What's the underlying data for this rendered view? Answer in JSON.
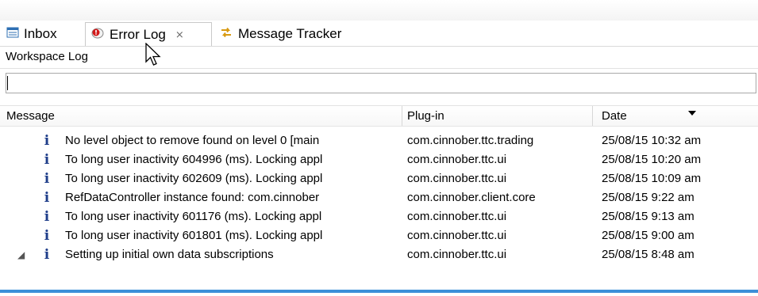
{
  "tabs": [
    {
      "label": "Inbox",
      "icon": "inbox-icon"
    },
    {
      "label": "Error Log",
      "icon": "error-log-icon",
      "close": "⨯"
    },
    {
      "label": "Message Tracker",
      "icon": "message-tracker-icon"
    }
  ],
  "view_title": "Workspace Log",
  "filter": {
    "value": "",
    "placeholder": ""
  },
  "columns": {
    "message": "Message",
    "plugin": "Plug-in",
    "date": "Date"
  },
  "rows": [
    {
      "message": "No level object to remove found on level 0 [main",
      "plugin": "com.cinnober.ttc.trading",
      "date": "25/08/15 10:32 am"
    },
    {
      "message": "To long user inactivity 604996 (ms). Locking appl",
      "plugin": "com.cinnober.ttc.ui",
      "date": "25/08/15 10:20 am"
    },
    {
      "message": "To long user inactivity 602609 (ms). Locking appl",
      "plugin": "com.cinnober.ttc.ui",
      "date": "25/08/15 10:09 am"
    },
    {
      "message": "RefDataController instance found: com.cinnober",
      "plugin": "com.cinnober.client.core",
      "date": "25/08/15 9:22 am"
    },
    {
      "message": "To long user inactivity 601176 (ms). Locking appl",
      "plugin": "com.cinnober.ttc.ui",
      "date": "25/08/15 9:13 am"
    },
    {
      "message": "To long user inactivity 601801 (ms). Locking appl",
      "plugin": "com.cinnober.ttc.ui",
      "date": "25/08/15 9:00 am"
    },
    {
      "message": "Setting up initial own data subscriptions",
      "plugin": "com.cinnober.ttc.ui",
      "date": "25/08/15 8:48 am"
    }
  ],
  "info_glyph": "i",
  "expander_glyph": "◢",
  "colors": {
    "accent": "#3c8fd8",
    "info": "#1f3e8a"
  }
}
